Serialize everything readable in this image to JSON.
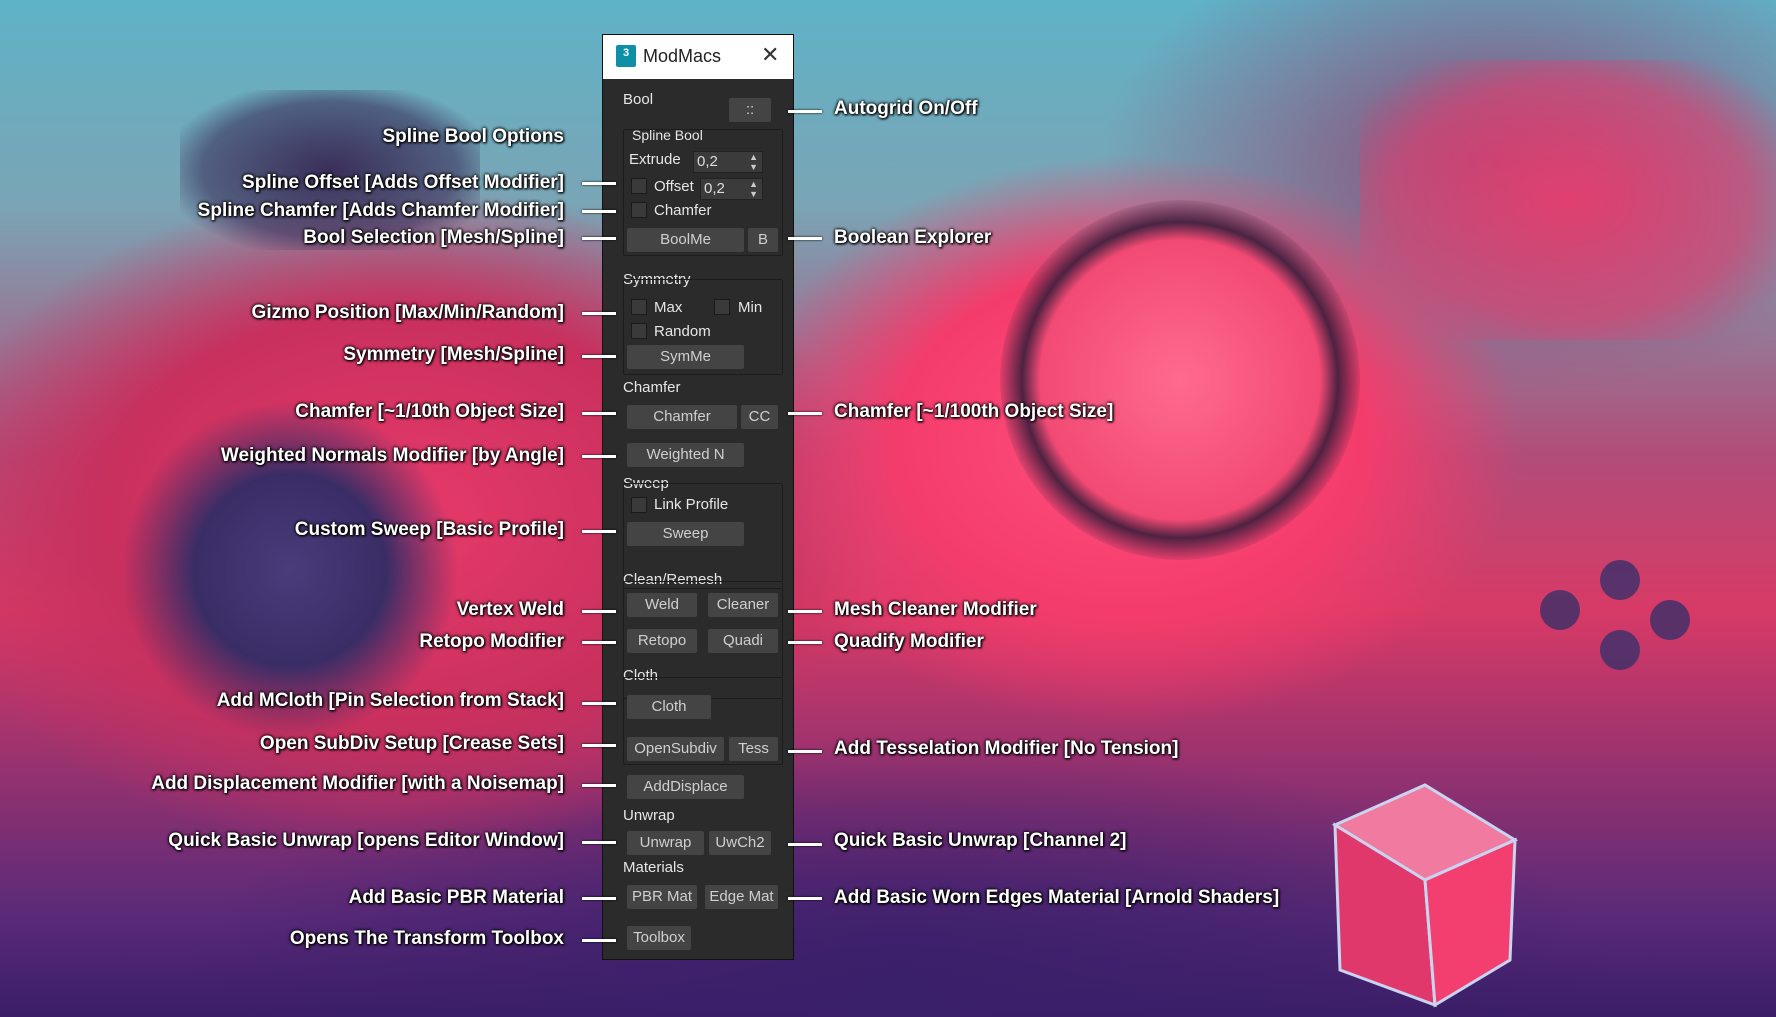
{
  "panel": {
    "title": "ModMacs",
    "logo_text": "3",
    "close_icon": "close-icon",
    "sections": {
      "bool": "Bool",
      "autogrid_btn": "::",
      "spline_bool": "Spline Bool",
      "extrude_label": "Extrude",
      "extrude_value": "0,2",
      "offset_label": "Offset",
      "offset_value": "0,2",
      "chamfer_chk": "Chamfer",
      "boolme_btn": "BoolMe",
      "b_btn": "B",
      "symmetry": "Symmetry",
      "max": "Max",
      "min": "Min",
      "random": "Random",
      "symme_btn": "SymMe",
      "chamfer": "Chamfer",
      "chamfer_btn": "Chamfer",
      "cc_btn": "CC",
      "weighted_btn": "Weighted N",
      "sweep": "Sweep",
      "link_profile": "Link Profile",
      "sweep_btn": "Sweep",
      "clean": "Clean/Remesh",
      "weld_btn": "Weld",
      "cleaner_btn": "Cleaner",
      "retopo_btn": "Retopo",
      "quadi_btn": "Quadi",
      "cloth": "Cloth",
      "cloth_btn": "Cloth",
      "opensubdiv_btn": "OpenSubdiv",
      "tess_btn": "Tess",
      "adddisplace_btn": "AddDisplace",
      "unwrap": "Unwrap",
      "unwrap_btn": "Unwrap",
      "uwch2_btn": "UwCh2",
      "materials": "Materials",
      "pbr_btn": "PBR Mat",
      "edge_btn": "Edge Mat",
      "toolbox_btn": "Toolbox"
    }
  },
  "annotations": {
    "left": {
      "spline_bool_options": "Spline Bool Options",
      "spline_offset": "Spline Offset [Adds Offset Modifier]",
      "spline_chamfer": "Spline Chamfer  [Adds Chamfer Modifier]",
      "bool_selection": "Bool Selection [Mesh/Spline]",
      "gizmo_position": "Gizmo Position [Max/Min/Random]",
      "symmetry": "Symmetry [Mesh/Spline]",
      "chamfer_10": "Chamfer [~1/10th Object Size]",
      "weighted_normals": "Weighted Normals Modifier [by Angle]",
      "custom_sweep": "Custom Sweep [Basic Profile]",
      "vertex_weld": "Vertex Weld",
      "retopo": "Retopo Modifier",
      "mcloth": "Add MCloth [Pin Selection from Stack]",
      "subdiv": "Open SubDiv Setup [Crease Sets]",
      "displacement": "Add Displacement Modifier [with a Noisemap]",
      "quick_unwrap": "Quick Basic Unwrap [opens Editor Window]",
      "pbr_material": "Add Basic PBR Material",
      "transform_toolbox": "Opens The Transform Toolbox"
    },
    "right": {
      "autogrid": "Autogrid On/Off",
      "boolean_explorer": "Boolean Explorer",
      "chamfer_100": "Chamfer [~1/100th Object Size]",
      "mesh_cleaner": "Mesh Cleaner Modifier",
      "quadify": "Quadify Modifier",
      "tesselation": "Add Tesselation Modifier [No Tension]",
      "unwrap_ch2": "Quick Basic Unwrap [Channel 2]",
      "worn_edges": "Add Basic Worn Edges Material [Arnold Shaders]"
    }
  },
  "colors": {
    "panel_bg": "#2b2b2b",
    "button_bg": "#444444",
    "accent_pink": "#f43c6c",
    "label_white": "#ffffff"
  }
}
